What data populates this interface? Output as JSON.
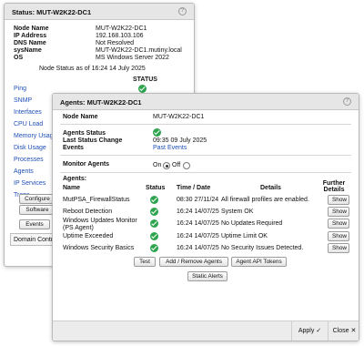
{
  "status_panel": {
    "title": "Status: MUT-W2K22-DC1",
    "fields": [
      {
        "label": "Node Name",
        "value": "MUT-W2K22-DC1"
      },
      {
        "label": "IP Address",
        "value": "192.168.103.106"
      },
      {
        "label": "DNS Name",
        "value": "Not Resolved"
      },
      {
        "label": "sysName",
        "value": "MUT-W2K22-DC1.mutiny.local"
      },
      {
        "label": "OS",
        "value": "MS Windows Server 2022"
      }
    ],
    "node_status_text": "Node Status as of 16:24 14 July 2025",
    "status_header": "STATUS",
    "nav_links": [
      "Ping",
      "SNMP",
      "Interfaces",
      "CPU Load",
      "Memory Usage",
      "Disk Usage",
      "Processes",
      "Agents",
      "IP Services",
      "Traps"
    ],
    "buttons": {
      "configure": "Configure",
      "software": "Software",
      "events": "Events"
    },
    "domain_field": "Domain Contro"
  },
  "agents_panel": {
    "title": "Agents: MUT-W2K22-DC1",
    "node_name_label": "Node Name",
    "node_name_value": "MUT-W2K22-DC1",
    "agents_status_label": "Agents Status",
    "last_status_change_label": "Last Status Change",
    "last_status_change_value": "09:35 09 July 2025",
    "events_label": "Events",
    "past_events_link": "Past Events",
    "monitor_agents_label": "Monitor Agents",
    "monitor_on": "On",
    "monitor_off": "Off",
    "agents_label": "Agents:",
    "table_headers": {
      "name": "Name",
      "status": "Status",
      "time": "Time / Date",
      "details": "Details",
      "further": "Further Details"
    },
    "rows": [
      {
        "name": "MutPSA_FirewallStatus",
        "time": "08:30 27/11/24",
        "details": "All firewall profiles are enabled.",
        "action": "Show"
      },
      {
        "name": "Reboot Detection",
        "time": "16:24 14/07/25",
        "details": "System OK",
        "action": "Show"
      },
      {
        "name": "Windows Updates Monitor (PS Agent)",
        "time": "16:24 14/07/25",
        "details": "No Updates Required",
        "action": "Show"
      },
      {
        "name": "Uptime Exceeded",
        "time": "16:24 14/07/25",
        "details": "Uptime Limit OK",
        "action": "Show"
      },
      {
        "name": "Windows Security Basics",
        "time": "16:24 14/07/25",
        "details": "No Security Issues Detected.",
        "action": "Show"
      }
    ],
    "buttons": {
      "test": "Test",
      "add_remove": "Add / Remove Agents",
      "api_tokens": "Agent API Tokens",
      "static_alerts": "Static Alerts"
    },
    "footer": {
      "apply": "Apply ✓",
      "close": "Close ✕"
    }
  },
  "colors": {
    "ok_green": "#2ea44f",
    "link_blue": "#1f4fb8"
  },
  "icons": [
    "help-icon",
    "check-circle-icon"
  ]
}
